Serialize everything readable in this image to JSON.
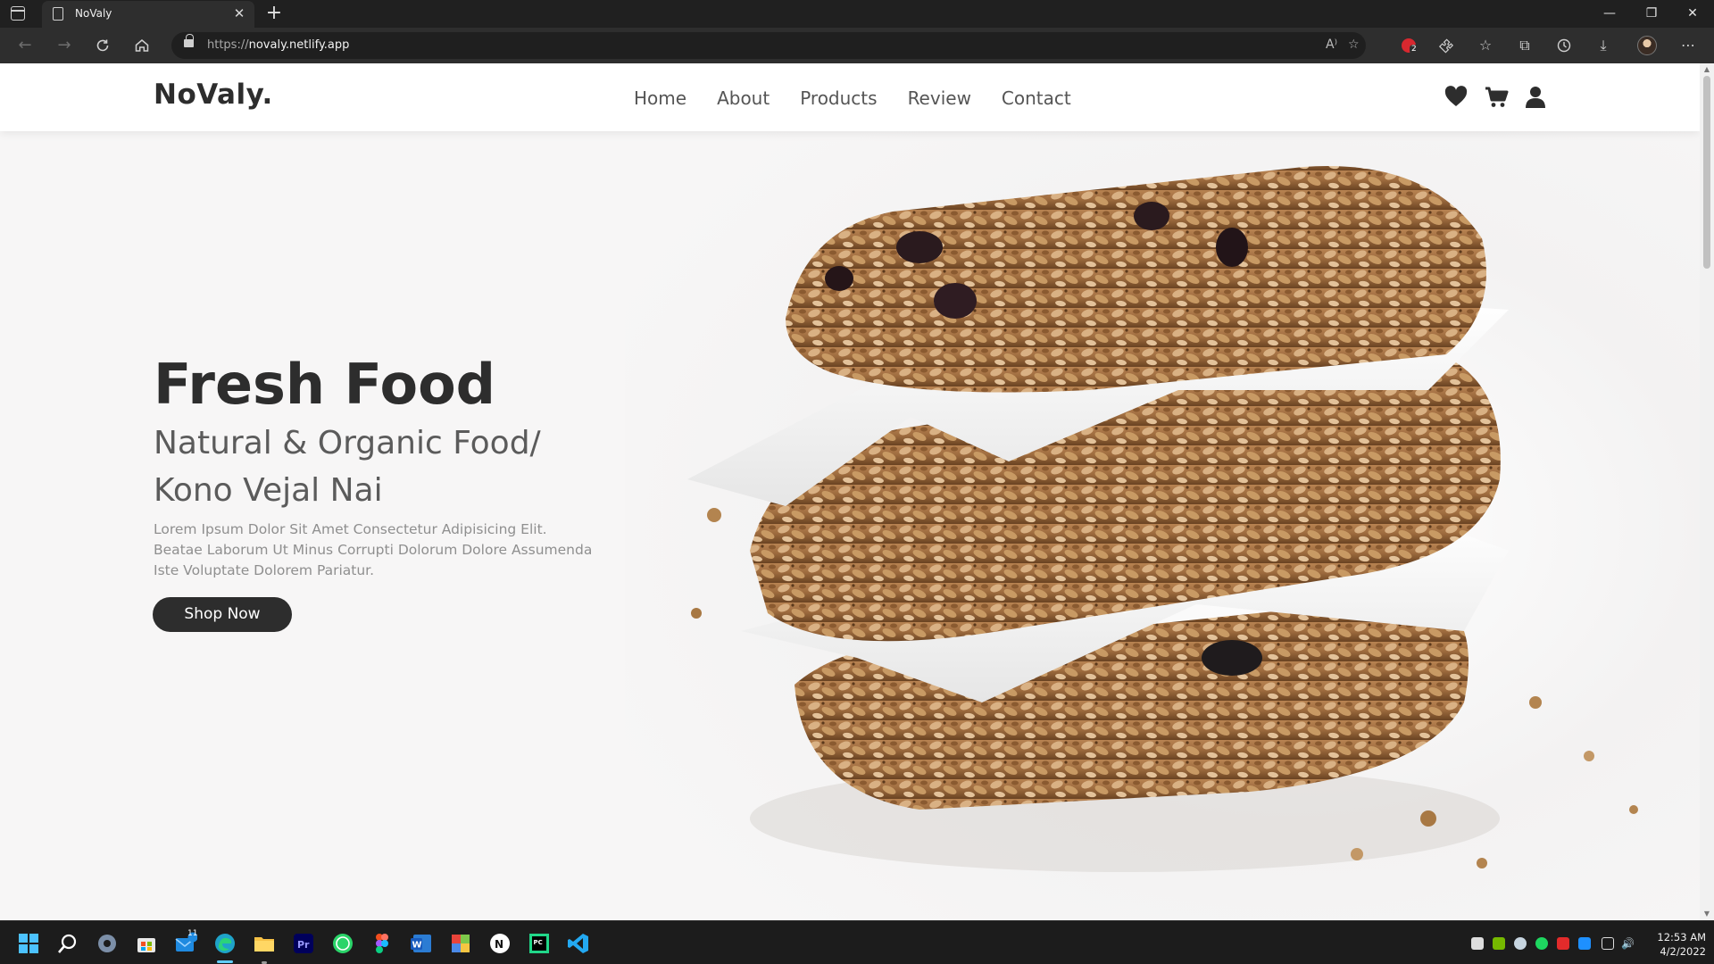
{
  "browser": {
    "tab_title": "NoValy",
    "url_protocol": "https://",
    "url_host": "novaly.netlify.app",
    "extension_badge_count": "2",
    "icons": [
      "back-icon",
      "forward-icon",
      "refresh-icon",
      "home-icon",
      "lock-icon",
      "read-aloud-icon",
      "add-favorite-icon",
      "extension-icon",
      "extensions-icon",
      "favorites-icon",
      "collections-icon",
      "history-icon",
      "downloads-icon",
      "profile-avatar",
      "more-icon"
    ]
  },
  "site": {
    "logo": "NoValy.",
    "nav": [
      "Home",
      "About",
      "Products",
      "Review",
      "Contact"
    ],
    "header_icons": [
      "heart-icon",
      "cart-icon",
      "user-icon"
    ],
    "hero": {
      "title": "Fresh Food",
      "subtitle_line1": "Natural & Organic Food/",
      "subtitle_line2": "Kono Vejal Nai",
      "description": "Lorem Ipsum Dolor Sit Amet Consectetur Adipisicing Elit. Beatae Laborum Ut Minus Corrupti Dolorum Dolore Assumenda Iste Voluptate Dolorem Pariatur.",
      "button": "Shop Now"
    }
  },
  "taskbar": {
    "apps": [
      "start-icon",
      "search-icon",
      "settings-icon",
      "store-icon",
      "mail-icon",
      "edge-icon",
      "file-explorer-icon",
      "premiere-icon",
      "whatsapp-icon",
      "figma-icon",
      "word-icon",
      "minecraft-icon",
      "notion-icon",
      "pycharm-icon",
      "vscode-icon"
    ],
    "mail_badge": "11",
    "time": "12:53 AM",
    "date": "4/2/2022"
  },
  "colors": {
    "accent": "#2d2d2d",
    "browser_dark": "#202020",
    "taskbar_active": "#60cdff"
  }
}
